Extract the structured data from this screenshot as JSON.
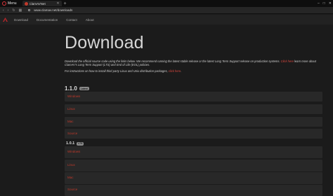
{
  "browser": {
    "menu_label": "Menu",
    "tab_title": "ClamAVNet",
    "url": "www.clamav.net/downloads",
    "window_controls": [
      "–",
      "□",
      "✕"
    ]
  },
  "sitenav": {
    "links": [
      "Download",
      "Documentation",
      "Contact",
      "About"
    ]
  },
  "main": {
    "title": "Download",
    "intro_before_link": "Download the official source code using the links below. We recommend running the latest stable release or the latest Long Term Support release on production systems. ",
    "intro_link": "Click here",
    "intro_after_link": " learn more about ClamAV's Long Term Support (LTS) and End of Life (EOL) policies.",
    "instr_before_link": "For instructions on how to install third party Linux and Unix distribution packages, ",
    "instr_link": "click here",
    "instr_after_link": "."
  },
  "releases": [
    {
      "version": "1.1.0",
      "badge": "Latest",
      "rows": [
        "Windows",
        "Linux",
        "Mac",
        "Source"
      ]
    },
    {
      "version": "1.0.1",
      "badge": "LTS",
      "rows": [
        "Windows",
        "Linux",
        "Mac",
        "Source"
      ]
    }
  ],
  "colors": {
    "accent": "#c0392b",
    "background": "#1b1b1b",
    "row_background": "#282828"
  }
}
